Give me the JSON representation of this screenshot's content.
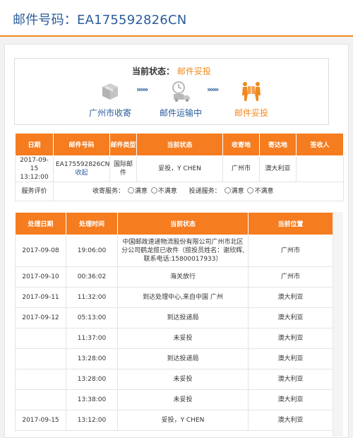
{
  "header": {
    "title": "邮件号码：EA175592826CN"
  },
  "status": {
    "label": "当前状态：",
    "value": "邮件妥投",
    "steps": [
      "广州市收寄",
      "邮件运输中",
      "邮件妥投"
    ],
    "arrow": "»»»"
  },
  "mail_table": {
    "headers": [
      "日期",
      "邮件号码",
      "邮件类型",
      "当前状态",
      "收寄地",
      "寄达地",
      "签收人"
    ],
    "row": {
      "date": "2017-09-15 13:12:00",
      "mail_no": "EA175592826CN",
      "collapse_link": "收起",
      "type": "国际邮件",
      "status": "妥投，Y CHEN",
      "origin": "广州市",
      "destination": "澳大利亚",
      "signer": ""
    },
    "evaluation": {
      "label": "服务评价",
      "pickup_label": "收寄服务：",
      "delivery_label": "投递服务：",
      "satisfied": "满意",
      "unsatisfied": "不满意"
    }
  },
  "track_table": {
    "headers": [
      "处理日期",
      "处理时间",
      "当前状态",
      "当前位置"
    ],
    "rows": [
      {
        "date": "2017-09-08",
        "time": "19:06:00",
        "status": "中国邮政速递物流股份有限公司广州市北区分公司鹤龙揽已收件（揽投员姓名：谢欣辉,联系电话:15800017933）",
        "location": "广州市"
      },
      {
        "date": "2017-09-10",
        "time": "00:36:02",
        "status": "海关放行",
        "location": "广州市"
      },
      {
        "date": "2017-09-11",
        "time": "11:32:00",
        "status": "到达处理中心,来自中国 广州",
        "location": "澳大利亚"
      },
      {
        "date": "2017-09-12",
        "time": "05:13:00",
        "status": "到达投递局",
        "location": "澳大利亚"
      },
      {
        "date": "",
        "time": "11:37:00",
        "status": "未妥投",
        "location": "澳大利亚"
      },
      {
        "date": "",
        "time": "13:28:00",
        "status": "到达投递局",
        "location": "澳大利亚"
      },
      {
        "date": "",
        "time": "13:28:00",
        "status": "未妥投",
        "location": "澳大利亚"
      },
      {
        "date": "",
        "time": "13:38:00",
        "status": "未妥投",
        "location": "澳大利亚"
      },
      {
        "date": "2017-09-15",
        "time": "13:12:00",
        "status": "妥投，Y CHEN",
        "location": "澳大利亚"
      }
    ]
  },
  "colors": {
    "accent": "#f57c1f",
    "link": "#2b5d9c",
    "icon_gray": "#bbbbbb"
  },
  "icons": [
    "package-icon",
    "transport-icon",
    "delivered-icon"
  ]
}
